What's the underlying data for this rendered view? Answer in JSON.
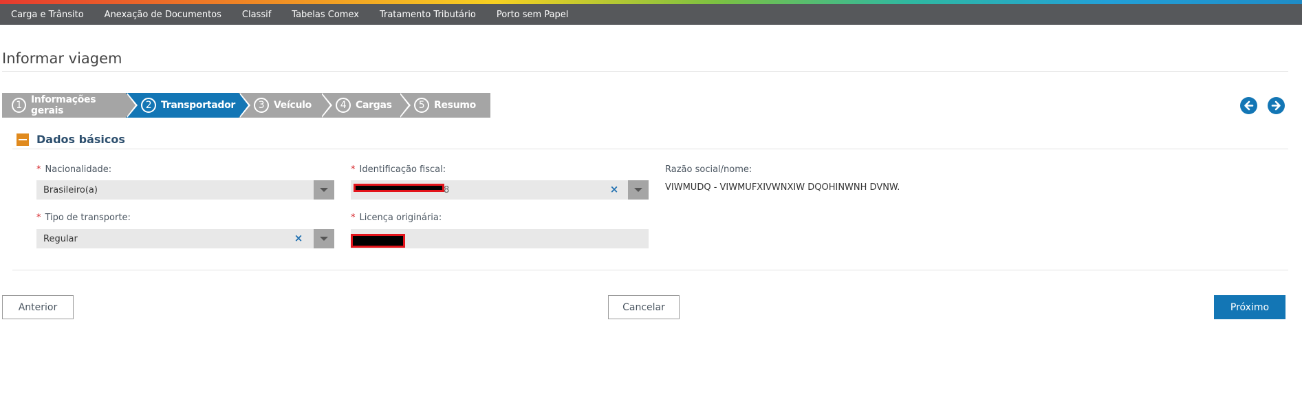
{
  "topnav": {
    "items": [
      "Carga e Trânsito",
      "Anexação de Documentos",
      "Classif",
      "Tabelas Comex",
      "Tratamento Tributário",
      "Porto sem Papel"
    ]
  },
  "page": {
    "title": "Informar viagem"
  },
  "wizard": {
    "active_step": 2,
    "steps": [
      {
        "number": "1",
        "label": "Informações gerais"
      },
      {
        "number": "2",
        "label": "Transportador"
      },
      {
        "number": "3",
        "label": "Veículo"
      },
      {
        "number": "4",
        "label": "Cargas"
      },
      {
        "number": "5",
        "label": "Resumo"
      }
    ]
  },
  "section": {
    "title": "Dados básicos",
    "fields": {
      "nacionalidade": {
        "label": "Nacionalidade:",
        "value": "Brasileiro(a)",
        "required": true
      },
      "identificacao_fiscal": {
        "label": "Identificação fiscal:",
        "value": "",
        "visible_suffix": "8",
        "required": true
      },
      "razao_social": {
        "label": "Razão social/nome:",
        "value": "VIWMUDQ - VIWMUFXIVWNXIW DQOHINWNH DVNW."
      },
      "tipo_transporte": {
        "label": "Tipo de transporte:",
        "value": "Regular",
        "required": true
      },
      "licenca_originaria": {
        "label": "Licença originária:",
        "value": "",
        "required": true
      }
    }
  },
  "buttons": {
    "previous": "Anterior",
    "cancel": "Cancelar",
    "next": "Próximo"
  },
  "colors": {
    "primary": "#1376b5",
    "nav_bg": "#56585b",
    "step_inactive": "#a5a5a5",
    "collapse": "#e08a1e",
    "required": "#d6262b",
    "redaction_border": "#e3141b"
  },
  "icons": {
    "prev_nav": "arrow-left-circle-icon",
    "next_nav": "arrow-right-circle-icon",
    "clear": "clear-x-icon",
    "dropdown": "caret-down-icon",
    "collapse": "minus-icon"
  }
}
